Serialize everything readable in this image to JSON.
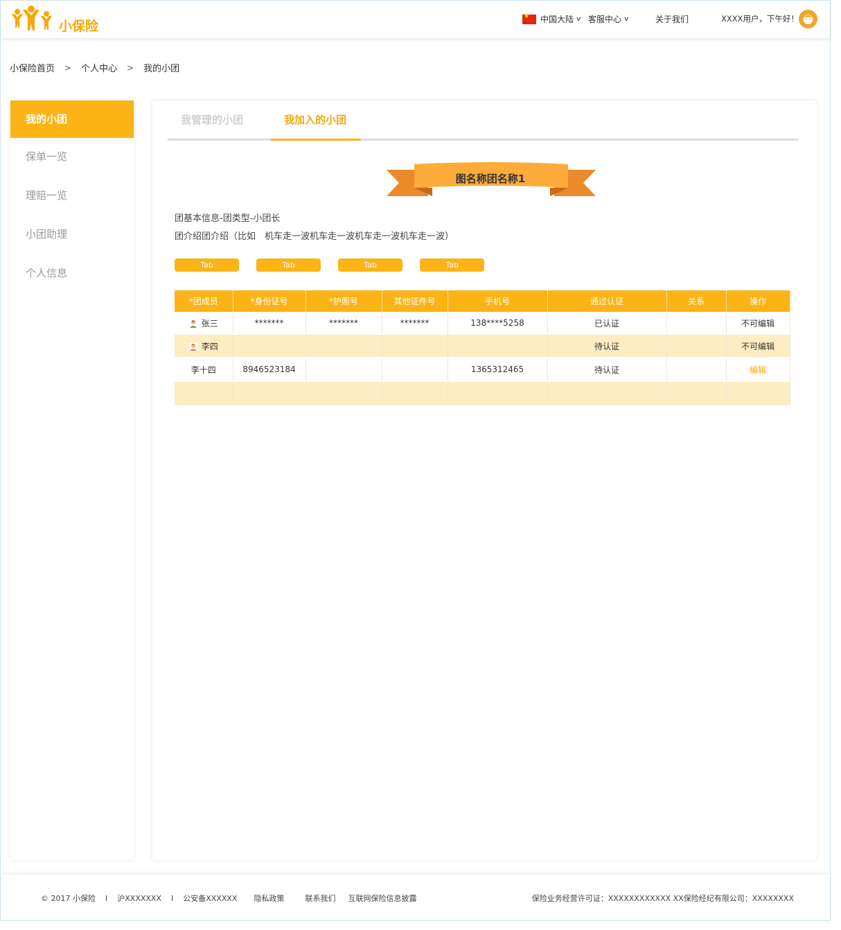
{
  "header": {
    "brand": "小保险",
    "region": "中国大陆",
    "service": "客服中心",
    "about": "关于我们",
    "greeting": "XXXX用户，下午好！"
  },
  "breadcrumb": [
    "小保险首页",
    "个人中心",
    "我的小团"
  ],
  "sidebar": {
    "items": [
      {
        "label": "我的小团"
      },
      {
        "label": "保单一览"
      },
      {
        "label": "理赔一览"
      },
      {
        "label": "小团助理"
      },
      {
        "label": "个人信息"
      }
    ]
  },
  "tabs": [
    "我管理的小团",
    "我加入的小团"
  ],
  "group": {
    "name": "图名称团名称1",
    "basic_info": "团基本信息-团类型-小团长",
    "intro": "团介绍团介绍（比如　机车走一波机车走一波机车走一波机车走一波）"
  },
  "pills": [
    "Tab",
    "Tab",
    "Tab",
    "Tab"
  ],
  "table": {
    "headers": [
      "*团成员",
      "*身份证号",
      "*护照号",
      "其他证件号",
      "手机号",
      "通过认证",
      "关系",
      "操作"
    ],
    "rows": [
      [
        "张三",
        "*******",
        "*******",
        "*******",
        "138****5258",
        "已认证",
        "",
        "不可编辑"
      ],
      [
        "李四",
        "",
        "",
        "",
        "",
        "待认证",
        "",
        "不可编辑"
      ],
      [
        "李十四",
        "8946523184",
        "",
        "",
        "1365312465",
        "待认证",
        "",
        "编辑"
      ],
      [
        "",
        "",
        "",
        "",
        "",
        "",
        "",
        ""
      ]
    ]
  },
  "footer": {
    "copyright": "© 2017 小保险",
    "sep": "I",
    "icp": "沪XXXXXXX",
    "police": "公安备XXXXXX",
    "privacy": "隐私政策",
    "contact": "联系我们",
    "disclosure": "互联网保险信息披露",
    "license": "保险业务经营许可证：XXXXXXXXXXXX XX保险经纪有限公司：XXXXXXXX"
  },
  "colors": {
    "accent": "#fcb316",
    "row_alt": "#ffecc2",
    "ribbon_dark": "#ea8a2b"
  }
}
